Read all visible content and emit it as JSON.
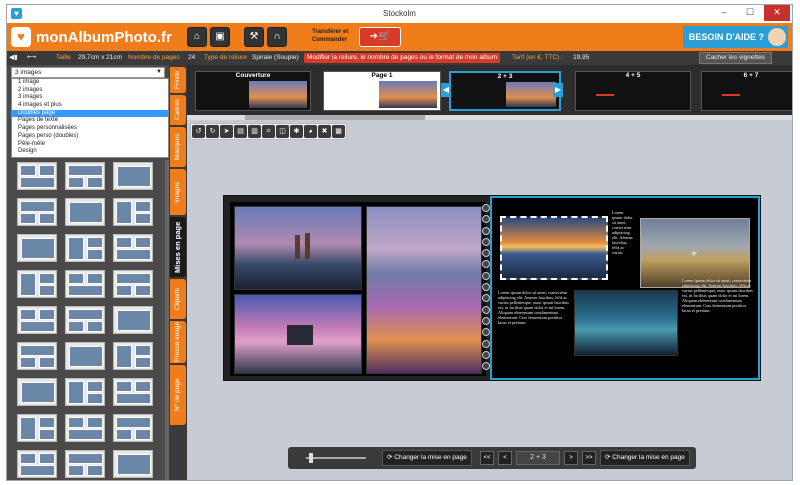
{
  "window": {
    "title": "Stockolm",
    "min": "–",
    "max": "☐",
    "close": "✕"
  },
  "topbar": {
    "logo": "monAlbumPhoto.fr",
    "transfer_line1": "Transférer et",
    "transfer_line2": "Commander",
    "help": "BESOIN D'AIDE ?"
  },
  "infobar": {
    "size_label": "Taille",
    "size_value": "29,7cm x 21cm",
    "pages_label": "Nombre de pages",
    "pages_value": "24",
    "binding_label": "Type de reliure",
    "binding_value": "Spirale (Souple)",
    "warning": "Modifier la reliure, le nombre de pages ou le format de mon album",
    "price_label": "Tarif (en €, TTC) :",
    "price_value": "19,95",
    "hide_thumbs": "Cacher les vignettes"
  },
  "layout_select": {
    "value": "3 images",
    "options": [
      "1 image",
      "2 images",
      "3 images",
      "4 images et plus",
      "Doubles page",
      "Pages de texte",
      "Pages personnalisées",
      "Pages perso (doubles)",
      "Pêle-mêle",
      "Design"
    ],
    "selected_index": 4
  },
  "side_tabs": [
    "Fonds",
    "Cadres",
    "Masques",
    "Images",
    "Mises en page",
    "Cliparts",
    "Presse-image",
    "N° de page"
  ],
  "active_tab": "Mises en page",
  "page_strip": [
    {
      "label": "Couverture"
    },
    {
      "label": "Page 1"
    },
    {
      "label": "2 + 3"
    },
    {
      "label": "4 + 5"
    },
    {
      "label": "6 + 7"
    }
  ],
  "lorem": "Lorem ipsum dolor sit amet, consectetur adipiscing elit. Aenean faucibus, felis ac varius pellentesque, nunc ipsum faucibus est, in facilisis quam dolor et mi lorem. Aliquam elementum condimentum elementum. Cras fermentum porttitor lacus et pretium.",
  "lorem_short": "Lorem ipsum dolor sit amet, consectetur adipiscing elit. Aenean faucibus, felis ac varius",
  "bottom": {
    "change_layout_left": "Changer la mise en page",
    "first": "<<",
    "prev": "<",
    "page": "2 + 3",
    "next": ">",
    "last": ">>",
    "change_layout_right": "Changer la mise en page"
  },
  "colors": {
    "accent": "#f07d1a",
    "blue": "#2a9fd6",
    "dark": "#3a3a3a"
  }
}
